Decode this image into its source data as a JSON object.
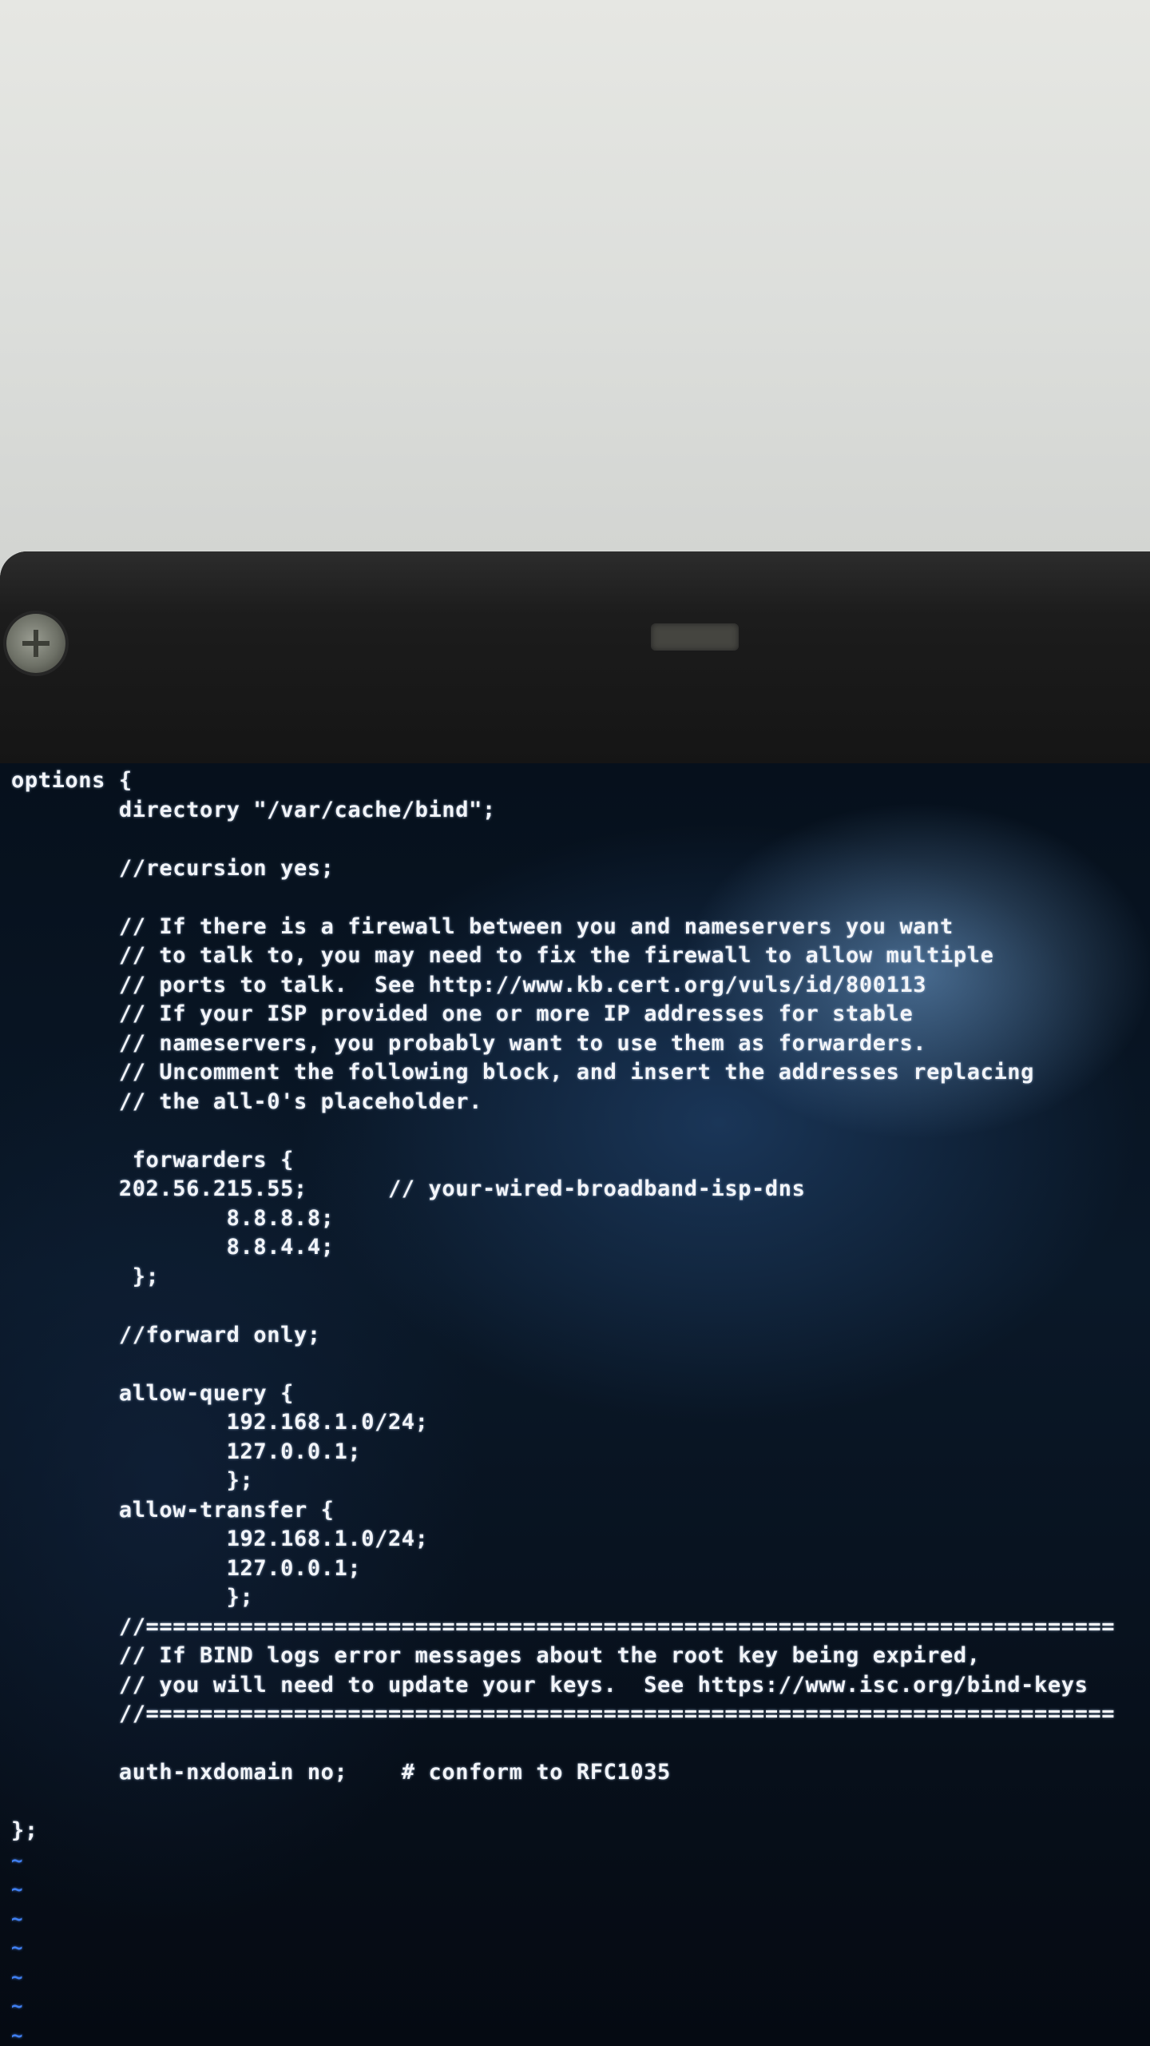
{
  "editor": {
    "lines": [
      "options {",
      "        directory \"/var/cache/bind\";",
      "",
      "        //recursion yes;",
      "",
      "        // If there is a firewall between you and nameservers you want",
      "        // to talk to, you may need to fix the firewall to allow multiple",
      "        // ports to talk.  See http://www.kb.cert.org/vuls/id/800113",
      "        // If your ISP provided one or more IP addresses for stable",
      "        // nameservers, you probably want to use them as forwarders.",
      "        // Uncomment the following block, and insert the addresses replacing",
      "        // the all-0's placeholder.",
      "",
      "         forwarders {",
      "        202.56.215.55;      // your-wired-broadband-isp-dns",
      "                8.8.8.8;",
      "                8.8.4.4;",
      "         };",
      "",
      "        //forward only;",
      "",
      "        allow-query {",
      "                192.168.1.0/24;",
      "                127.0.0.1;",
      "                };",
      "        allow-transfer {",
      "                192.168.1.0/24;",
      "                127.0.0.1;",
      "                };",
      "        //========================================================================",
      "        // If BIND logs error messages about the root key being expired,",
      "        // you will need to update your keys.  See https://www.isc.org/bind-keys",
      "        //========================================================================",
      "",
      "        auth-nxdomain no;    # conform to RFC1035",
      "",
      "};"
    ],
    "tilde_lines": [
      "~",
      "~",
      "~",
      "~",
      "~",
      "~",
      "~"
    ]
  }
}
